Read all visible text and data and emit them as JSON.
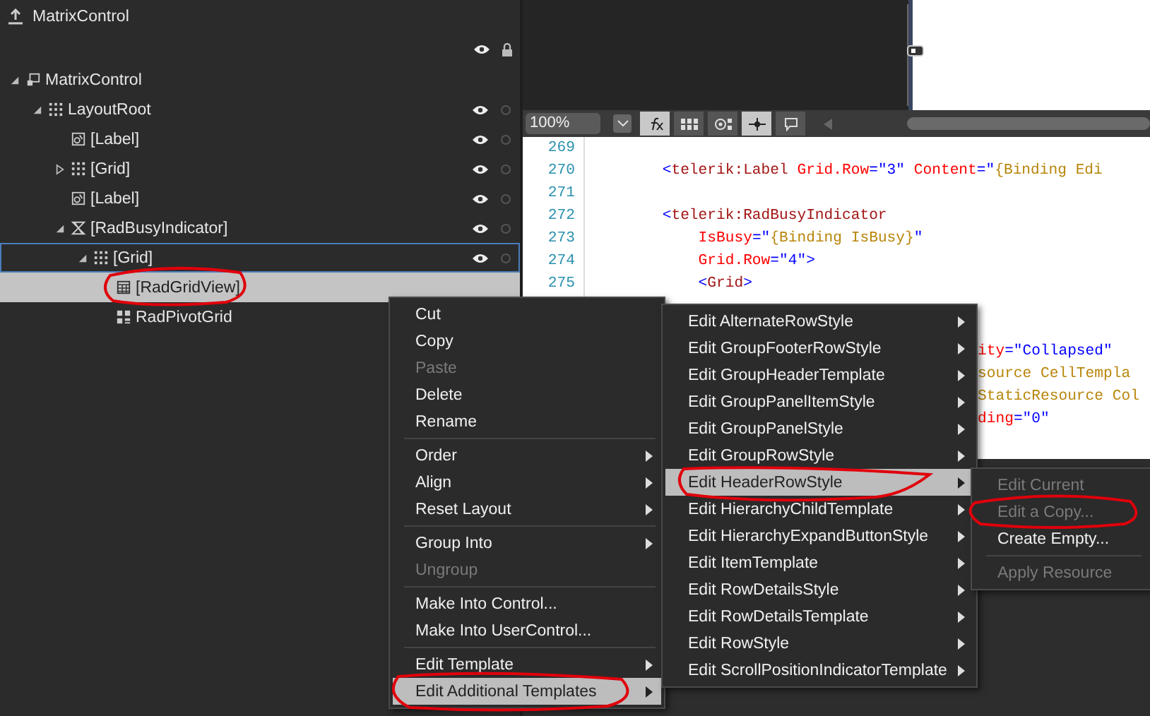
{
  "explorer": {
    "title": "MatrixControl",
    "tree": [
      {
        "label": "MatrixControl",
        "kind": "usercontrol",
        "expanded": true,
        "selected": false,
        "highlighted": false,
        "toggles": false,
        "children": [
          {
            "label": "LayoutRoot",
            "kind": "grid",
            "expanded": true,
            "selected": false,
            "highlighted": false,
            "toggles": true,
            "children": [
              {
                "label": "[Label]",
                "kind": "label",
                "selected": false,
                "highlighted": false,
                "toggles": true
              },
              {
                "label": "[Grid]",
                "kind": "grid",
                "expanded": false,
                "selected": false,
                "highlighted": false,
                "toggles": true
              },
              {
                "label": "[Label]",
                "kind": "label",
                "selected": false,
                "highlighted": false,
                "toggles": true
              },
              {
                "label": "[RadBusyIndicator]",
                "kind": "busy",
                "expanded": true,
                "selected": false,
                "highlighted": false,
                "toggles": true,
                "children": [
                  {
                    "label": "[Grid]",
                    "kind": "grid",
                    "expanded": true,
                    "selected": true,
                    "highlighted": false,
                    "toggles": true,
                    "children": [
                      {
                        "label": "[RadGridView]",
                        "kind": "gridview",
                        "selected": false,
                        "highlighted": true,
                        "toggles": false
                      },
                      {
                        "label": "RadPivotGrid",
                        "kind": "pivot",
                        "selected": false,
                        "highlighted": false
                      }
                    ]
                  }
                ]
              }
            ]
          }
        ]
      }
    ]
  },
  "toolbar": {
    "zoom": "100%",
    "buttons": [
      {
        "kind": "fx",
        "selected": true
      },
      {
        "kind": "grid",
        "selected": false
      },
      {
        "kind": "snap",
        "selected": false
      },
      {
        "kind": "crosshair",
        "selected": true
      },
      {
        "kind": "comment",
        "selected": false
      }
    ]
  },
  "editor": {
    "lines": [
      {
        "kind": "line",
        "number": "269"
      },
      {
        "kind": "line",
        "number": "270",
        "segments": [
          {
            "kind": "p",
            "text": "        <"
          },
          {
            "kind": "el",
            "text": "telerik:Label"
          },
          {
            "kind": "at",
            "text": " Grid.Row"
          },
          {
            "kind": "p",
            "text": "=\"3\""
          },
          {
            "kind": "at",
            "text": " Content"
          },
          {
            "kind": "p",
            "text": "=\""
          },
          {
            "kind": "mk",
            "text": "{Binding Edi"
          }
        ]
      },
      {
        "kind": "line",
        "number": "271"
      },
      {
        "kind": "line",
        "number": "272",
        "segments": [
          {
            "kind": "p",
            "text": "        <"
          },
          {
            "kind": "el",
            "text": "telerik:RadBusyIndicator"
          }
        ]
      },
      {
        "kind": "line",
        "number": "273",
        "segments": [
          {
            "kind": "at",
            "text": "            IsBusy"
          },
          {
            "kind": "p",
            "text": "=\""
          },
          {
            "kind": "mk",
            "text": "{Binding IsBusy}"
          },
          {
            "kind": "p",
            "text": "\""
          }
        ]
      },
      {
        "kind": "line",
        "number": "274",
        "segments": [
          {
            "kind": "at",
            "text": "            Grid.Row"
          },
          {
            "kind": "p",
            "text": "=\"4\">"
          }
        ]
      },
      {
        "kind": "line",
        "number": "275",
        "segments": [
          {
            "kind": "p",
            "text": "            <"
          },
          {
            "kind": "el",
            "text": "Grid"
          },
          {
            "kind": "p",
            "text": ">"
          }
        ]
      },
      {
        "kind": "hidden"
      },
      {
        "kind": "hidden"
      },
      {
        "kind": "fragment",
        "segments": [
          {
            "kind": "at",
            "text": "ity"
          },
          {
            "kind": "p",
            "text": "=\"Collapsed\""
          }
        ]
      },
      {
        "kind": "fragment",
        "segments": [
          {
            "kind": "mk",
            "text": "source CellTempla"
          }
        ]
      },
      {
        "kind": "fragment",
        "segments": [
          {
            "kind": "mk",
            "text": "StaticResource Col"
          }
        ]
      },
      {
        "kind": "fragment",
        "segments": [
          {
            "kind": "at",
            "text": "ding"
          },
          {
            "kind": "p",
            "text": "=\"0\""
          }
        ]
      }
    ]
  },
  "context_menu": {
    "items": [
      {
        "kind": "item",
        "label": "Cut",
        "disabled": false,
        "submenu": false,
        "highlighted": false
      },
      {
        "kind": "item",
        "label": "Copy",
        "disabled": false,
        "submenu": false,
        "highlighted": false
      },
      {
        "kind": "item",
        "label": "Paste",
        "disabled": true,
        "submenu": false,
        "highlighted": false
      },
      {
        "kind": "item",
        "label": "Delete",
        "disabled": false,
        "submenu": false,
        "highlighted": false
      },
      {
        "kind": "item",
        "label": "Rename",
        "disabled": false,
        "submenu": false,
        "highlighted": false
      },
      {
        "kind": "separator"
      },
      {
        "kind": "item",
        "label": "Order",
        "disabled": false,
        "submenu": true,
        "highlighted": false
      },
      {
        "kind": "item",
        "label": "Align",
        "disabled": false,
        "submenu": true,
        "highlighted": false
      },
      {
        "kind": "item",
        "label": "Reset Layout",
        "disabled": false,
        "submenu": true,
        "highlighted": false
      },
      {
        "kind": "separator"
      },
      {
        "kind": "item",
        "label": "Group Into",
        "disabled": false,
        "submenu": true,
        "highlighted": false
      },
      {
        "kind": "item",
        "label": "Ungroup",
        "disabled": true,
        "submenu": false,
        "highlighted": false
      },
      {
        "kind": "separator"
      },
      {
        "kind": "item",
        "label": "Make Into Control...",
        "disabled": false,
        "submenu": false,
        "highlighted": false
      },
      {
        "kind": "item",
        "label": "Make Into UserControl...",
        "disabled": false,
        "submenu": false,
        "highlighted": false
      },
      {
        "kind": "separator"
      },
      {
        "kind": "item",
        "label": "Edit Template",
        "disabled": false,
        "submenu": true,
        "highlighted": false
      },
      {
        "kind": "item",
        "label": "Edit Additional Templates",
        "disabled": false,
        "submenu": true,
        "highlighted": true
      }
    ]
  },
  "templates_menu": {
    "items": [
      {
        "kind": "item",
        "label": "Edit AlternateRowStyle",
        "disabled": false,
        "submenu": true,
        "highlighted": false
      },
      {
        "kind": "item",
        "label": "Edit GroupFooterRowStyle",
        "disabled": false,
        "submenu": true,
        "highlighted": false
      },
      {
        "kind": "item",
        "label": "Edit GroupHeaderTemplate",
        "disabled": false,
        "submenu": true,
        "highlighted": false
      },
      {
        "kind": "item",
        "label": "Edit GroupPanelItemStyle",
        "disabled": false,
        "submenu": true,
        "highlighted": false
      },
      {
        "kind": "item",
        "label": "Edit GroupPanelStyle",
        "disabled": false,
        "submenu": true,
        "highlighted": false
      },
      {
        "kind": "item",
        "label": "Edit GroupRowStyle",
        "disabled": false,
        "submenu": true,
        "highlighted": false
      },
      {
        "kind": "item",
        "label": "Edit HeaderRowStyle",
        "disabled": false,
        "submenu": true,
        "highlighted": true
      },
      {
        "kind": "item",
        "label": "Edit HierarchyChildTemplate",
        "disabled": false,
        "submenu": true,
        "highlighted": false
      },
      {
        "kind": "item",
        "label": "Edit HierarchyExpandButtonStyle",
        "disabled": false,
        "submenu": true,
        "highlighted": false
      },
      {
        "kind": "item",
        "label": "Edit ItemTemplate",
        "disabled": false,
        "submenu": true,
        "highlighted": false
      },
      {
        "kind": "item",
        "label": "Edit RowDetailsStyle",
        "disabled": false,
        "submenu": true,
        "highlighted": false
      },
      {
        "kind": "item",
        "label": "Edit RowDetailsTemplate",
        "disabled": false,
        "submenu": true,
        "highlighted": false
      },
      {
        "kind": "item",
        "label": "Edit RowStyle",
        "disabled": false,
        "submenu": true,
        "highlighted": false
      },
      {
        "kind": "item",
        "label": "Edit ScrollPositionIndicatorTemplate",
        "disabled": false,
        "submenu": true,
        "highlighted": false
      }
    ]
  },
  "style_menu": {
    "items": [
      {
        "kind": "item",
        "label": "Edit Current",
        "disabled": true,
        "submenu": false,
        "highlighted": false
      },
      {
        "kind": "item",
        "label": "Edit a Copy...",
        "disabled": true,
        "submenu": false,
        "highlighted": false
      },
      {
        "kind": "item",
        "label": "Create Empty...",
        "disabled": false,
        "submenu": false,
        "highlighted": false
      },
      {
        "kind": "separator"
      },
      {
        "kind": "item",
        "label": "Apply Resource",
        "disabled": true,
        "submenu": false,
        "highlighted": false
      }
    ]
  }
}
